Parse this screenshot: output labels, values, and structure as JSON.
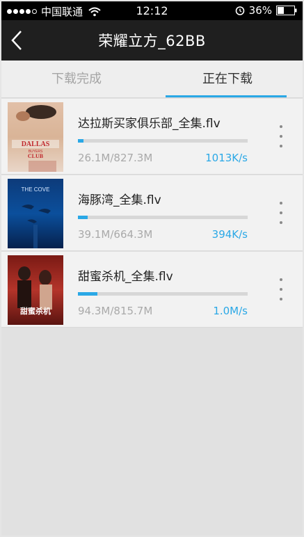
{
  "status_bar": {
    "carrier": "中国联通",
    "time": "12:12",
    "battery": "36%"
  },
  "nav": {
    "title": "荣耀立方_62BB"
  },
  "tabs": [
    {
      "label": "下载完成",
      "active": false
    },
    {
      "label": "正在下载",
      "active": true
    }
  ],
  "downloads": [
    {
      "title": "达拉斯买家俱乐部_全集.flv",
      "size": "26.1M/827.3M",
      "speed": "1013K/s",
      "progress": 0.0315,
      "poster_text": "DALLAS BUYERS CLUB"
    },
    {
      "title": "海豚湾_全集.flv",
      "size": "39.1M/664.3M",
      "speed": "394K/s",
      "progress": 0.0589,
      "poster_text": "THE COVE"
    },
    {
      "title": "甜蜜杀机_全集.flv",
      "size": "94.3M/815.7M",
      "speed": "1.0M/s",
      "progress": 0.1156,
      "poster_text": "甜蜜杀机"
    }
  ],
  "colors": {
    "accent": "#2aa8e6",
    "nav_bg": "#1f1f1f"
  }
}
